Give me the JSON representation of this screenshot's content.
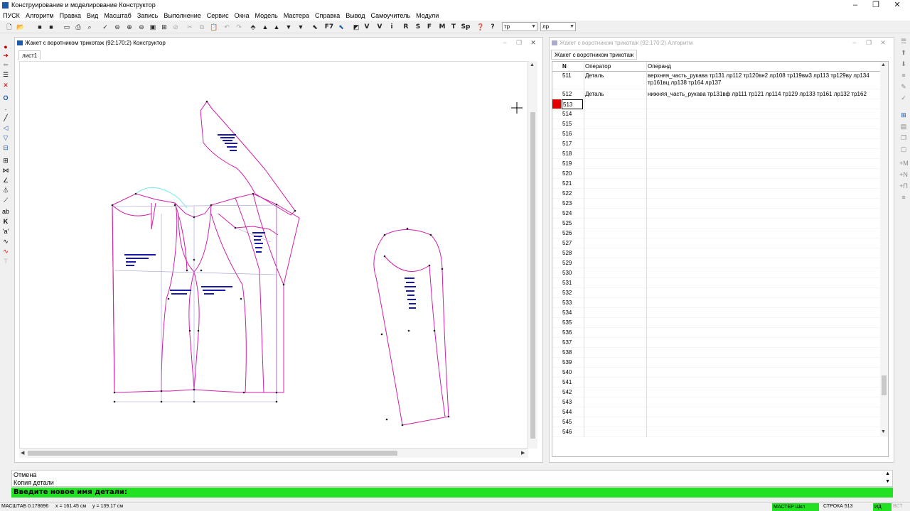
{
  "app": {
    "title": "Конструирование и моделирование  Конструктор"
  },
  "menu": [
    "ПУСК",
    "Алгоритм",
    "Правка",
    "Вид",
    "Масштаб",
    "Запись",
    "Выполнение",
    "Сервис",
    "Окна",
    "Модель",
    "Мастера",
    "Справка",
    "Вывод",
    "Самоучитель",
    "Модули"
  ],
  "toolbar": {
    "letters": [
      "F7",
      "M",
      "T",
      "Sp",
      "R",
      "S",
      "F",
      "V",
      "i",
      "?"
    ],
    "combo1": "тр",
    "combo2": "лр"
  },
  "canvas_window": {
    "title": "Жакет с воротником трикотаж (92:170:2) Конструктор",
    "tab": "лист1"
  },
  "algorithm_window": {
    "title": "Жакет с воротником трикотаж (92:170:2) Алгоритм",
    "tab": "Жакет с воротником трикотаж",
    "columns": {
      "n": "N",
      "operator": "Оператор",
      "operand": "Операнд"
    },
    "rows": [
      {
        "n": "511",
        "operator": "Деталь",
        "operand": "верхняя_часть_рукава тр131 лр112 тр120вн2 лр108 тр119вм3 лр113 тр129вy лр134 тр161вц лр138 тр164 лр137"
      },
      {
        "n": "512",
        "operator": "Деталь",
        "operand": "нижняя_часть_рукава тр131вф лр111 тр121 лр114 тр129 лр133 тр161 лр132 тр162 лр136"
      },
      {
        "n": "513",
        "operator": "",
        "operand": "",
        "selected": true
      },
      {
        "n": "514"
      },
      {
        "n": "515"
      },
      {
        "n": "516"
      },
      {
        "n": "517"
      },
      {
        "n": "518"
      },
      {
        "n": "519"
      },
      {
        "n": "520"
      },
      {
        "n": "521"
      },
      {
        "n": "522"
      },
      {
        "n": "523"
      },
      {
        "n": "524"
      },
      {
        "n": "525"
      },
      {
        "n": "526"
      },
      {
        "n": "527"
      },
      {
        "n": "528"
      },
      {
        "n": "529"
      },
      {
        "n": "530"
      },
      {
        "n": "531"
      },
      {
        "n": "532"
      },
      {
        "n": "533"
      },
      {
        "n": "534"
      },
      {
        "n": "535"
      },
      {
        "n": "536"
      },
      {
        "n": "537"
      },
      {
        "n": "538"
      },
      {
        "n": "539"
      },
      {
        "n": "540"
      },
      {
        "n": "541"
      },
      {
        "n": "542"
      },
      {
        "n": "543"
      },
      {
        "n": "544"
      },
      {
        "n": "545"
      },
      {
        "n": "546"
      }
    ]
  },
  "command_log": [
    "Отмена",
    "Копия детали"
  ],
  "prompt": "Введите новое имя детали:",
  "status": {
    "scale": "МАСШТАБ 0.178696",
    "x": "x = 161.45 см",
    "y": "y = 139.17 см",
    "master": "МАСТЕР Шкл",
    "line": "СТРОКА 513",
    "ind1": "ИД",
    "ind2": "ВСТ"
  },
  "colors": {
    "pattern": "#d21fa8",
    "label": "#1a1aa8",
    "prompt_bg": "#22e022",
    "selected_row": "#e00000"
  }
}
